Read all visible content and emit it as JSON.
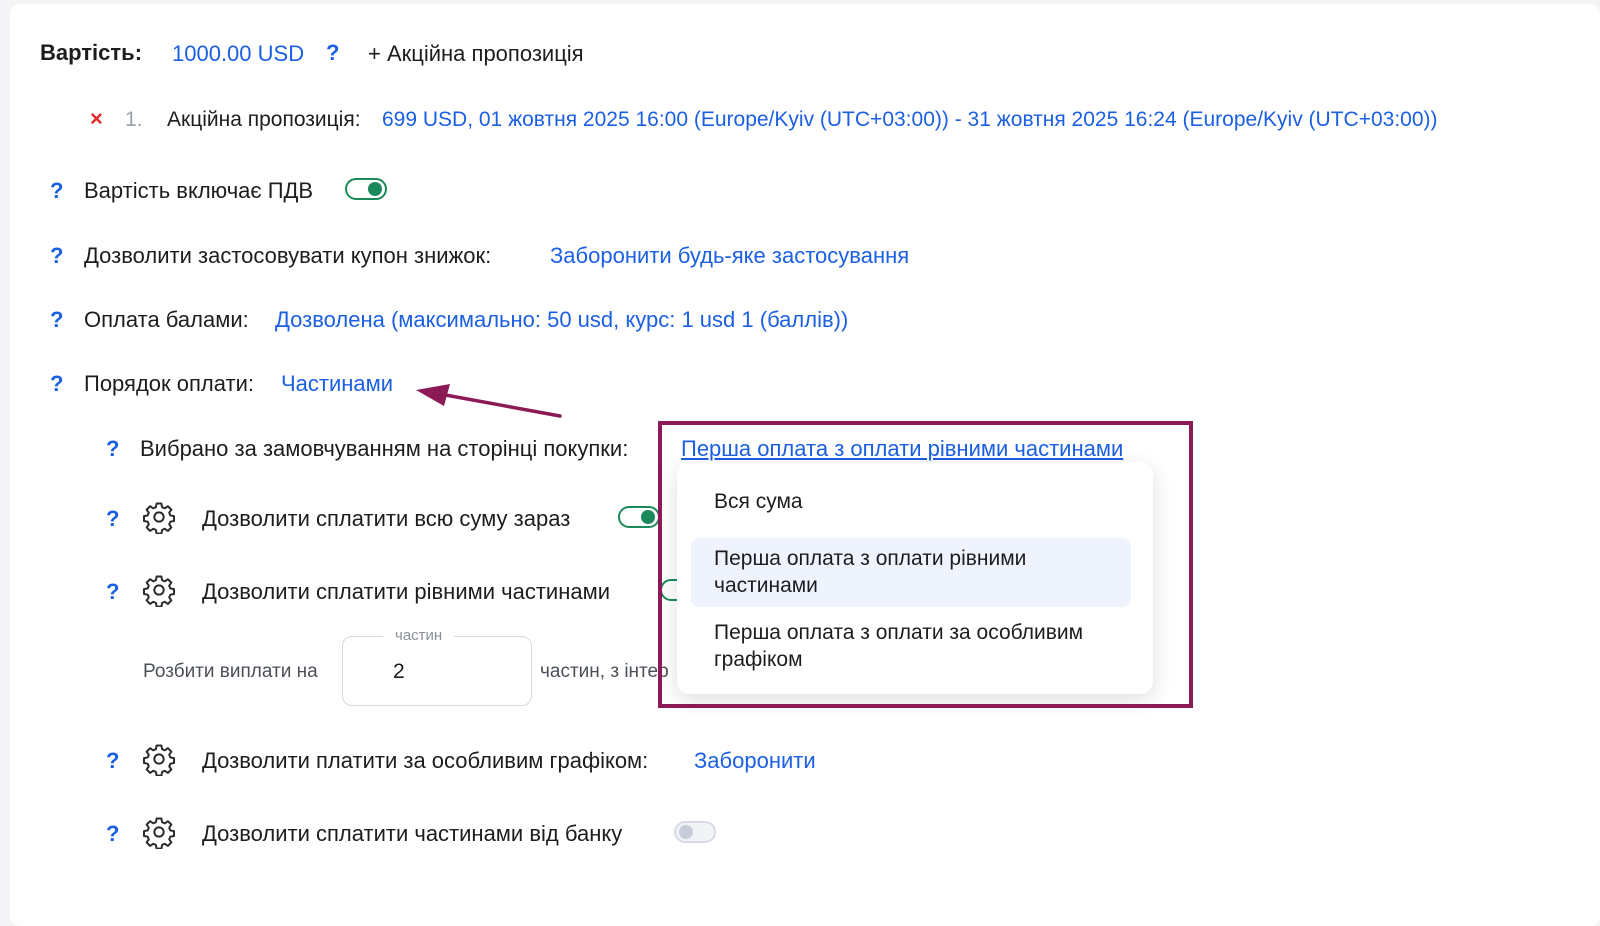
{
  "price": {
    "label": "Вартість:",
    "value": "1000.00 USD",
    "help": "?",
    "add_promo": "+ Акційна пропозиція"
  },
  "promo": {
    "remove": "×",
    "index": "1.",
    "label": "Акційна пропозиція:",
    "details": "699 USD, 01 жовтня 2025 16:00 (Europe/Kyiv (UTC+03:00)) - 31 жовтня 2025 16:24 (Europe/Kyiv (UTC+03:00))"
  },
  "settings": {
    "vat": {
      "help": "?",
      "label": "Вартість включає ПДВ",
      "enabled": true
    },
    "coupon": {
      "help": "?",
      "label": "Дозволити застосовувати купон знижок:",
      "value": "Заборонити будь-яке застосування"
    },
    "points": {
      "help": "?",
      "label": "Оплата балами:",
      "value": "Дозволена (максимально: 50 usd, курс: 1 usd 1 (баллів))"
    },
    "payment_order": {
      "help": "?",
      "label": "Порядок оплати:",
      "value": "Частинами"
    }
  },
  "installments": {
    "default": {
      "help": "?",
      "label": "Вибрано за замовчуванням на сторінці покупки:",
      "value": "Перша оплата з оплати рівними частинами"
    },
    "full_now": {
      "help": "?",
      "label": "Дозволити сплатити всю суму зараз",
      "enabled": true
    },
    "equal_parts": {
      "help": "?",
      "label": "Дозволити сплатити рівними частинами"
    },
    "split": {
      "prefix": "Розбити виплати на",
      "field_label": "частин",
      "field_value": "2",
      "suffix": "частин, з інтер"
    },
    "custom_schedule": {
      "help": "?",
      "label": "Дозволити платити за особливим графіком:",
      "value": "Заборонити"
    },
    "bank_parts": {
      "help": "?",
      "label": "Дозволити сплатити частинами від банку",
      "enabled": false
    }
  },
  "dropdown": {
    "options": [
      {
        "label": "Вся сума",
        "selected": false
      },
      {
        "label": "Перша оплата з оплати рівними частинами",
        "selected": true
      },
      {
        "label": "Перша оплата з оплати за особливим графіком",
        "selected": false
      }
    ]
  },
  "colors": {
    "link": "#1b5fe3",
    "toggle_on": "#1a8a5a",
    "annotation": "#8b1a57"
  }
}
